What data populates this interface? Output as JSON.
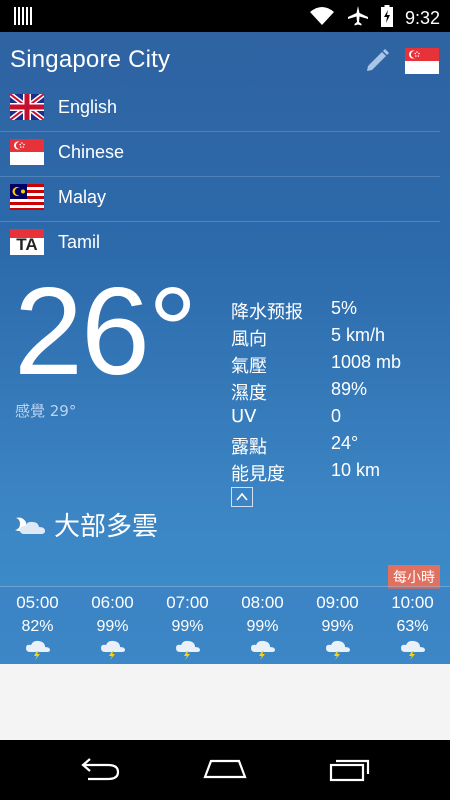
{
  "status": {
    "time": "9:32",
    "icons": [
      "barcode-icon",
      "wifi-icon",
      "airplane-icon",
      "battery-charging-icon"
    ]
  },
  "header": {
    "city": "Singapore City"
  },
  "languages": [
    {
      "label": "English",
      "flag": "uk-flag"
    },
    {
      "label": "Chinese",
      "flag": "singapore-flag"
    },
    {
      "label": "Malay",
      "flag": "malaysia-flag"
    },
    {
      "label": "Tamil",
      "flag": "tamil-flag"
    }
  ],
  "flag_text": {
    "tamil": "TA"
  },
  "current": {
    "temperature": "26°",
    "feels_like": "感覺 29°",
    "condition": "大部多雲"
  },
  "details": [
    {
      "label": "降水预报",
      "value": "5%"
    },
    {
      "label": "風向",
      "value": "5 km/h"
    },
    {
      "label": "氣壓",
      "value": "1008 mb"
    },
    {
      "label": "濕度",
      "value": "89%"
    },
    {
      "label": "UV",
      "value": "0"
    },
    {
      "label": "露點",
      "value": "24°"
    },
    {
      "label": "能見度",
      "value": "10 km"
    }
  ],
  "hourly": {
    "badge": "每小時",
    "items": [
      {
        "time": "05:00",
        "pct": "82%",
        "icon": "thunderstorm-icon"
      },
      {
        "time": "06:00",
        "pct": "99%",
        "icon": "thunderstorm-icon"
      },
      {
        "time": "07:00",
        "pct": "99%",
        "icon": "thunderstorm-icon"
      },
      {
        "time": "08:00",
        "pct": "99%",
        "icon": "thunderstorm-icon"
      },
      {
        "time": "09:00",
        "pct": "99%",
        "icon": "thunderstorm-icon"
      },
      {
        "time": "10:00",
        "pct": "63%",
        "icon": "thunderstorm-icon"
      }
    ]
  },
  "colors": {
    "background_top": "#2f63a2",
    "background_bottom": "#3d8fcc",
    "badge": "#e2705e",
    "singapore_red": "#e8323a",
    "uk_blue": "#1b2f8a"
  }
}
